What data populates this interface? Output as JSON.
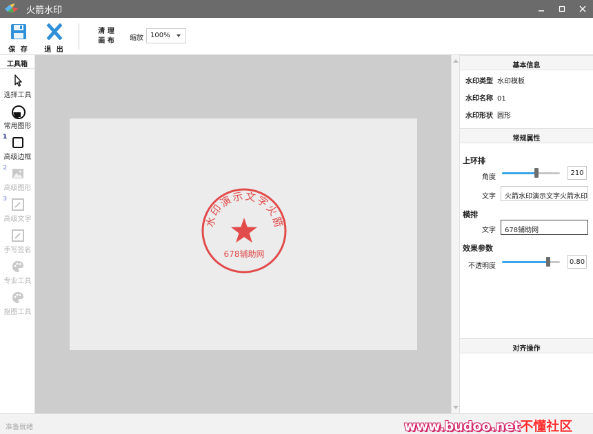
{
  "window": {
    "title": "火箭水印"
  },
  "toolbar": {
    "save_label": "保 存",
    "exit_label": "退 出",
    "clear_line1": "清 理",
    "clear_line2": "画 布",
    "zoom_label": "缩放",
    "zoom_value": "100%"
  },
  "toolbox": {
    "title": "工具箱",
    "tools": [
      {
        "label": "选择工具",
        "icon": "cursor-icon",
        "enabled": true
      },
      {
        "label": "常用图形",
        "icon": "circle-shape-icon",
        "enabled": true
      },
      {
        "label": "高级边框",
        "icon": "square-border-icon",
        "enabled": true,
        "badge": "1"
      },
      {
        "label": "高级图形",
        "icon": "image-icon",
        "enabled": false,
        "badge": "2"
      },
      {
        "label": "高级文字",
        "icon": "pen-icon",
        "enabled": false,
        "badge": "3"
      },
      {
        "label": "手写签名",
        "icon": "signature-pen-icon",
        "enabled": false
      },
      {
        "label": "专业工具",
        "icon": "palette-icon",
        "enabled": false
      },
      {
        "label": "抠图工具",
        "icon": "palette-icon",
        "enabled": false
      }
    ]
  },
  "stamp": {
    "ring_text": "火箭水印演示文字火箭水印",
    "center_text": "678辅助网",
    "color": "#e24b4b"
  },
  "panel": {
    "basic_info_title": "基本信息",
    "type_key": "水印类型",
    "type_value": "水印模板",
    "name_key": "水印名称",
    "name_value": "01",
    "shape_key": "水印形状",
    "shape_value": "圆形",
    "general_title": "常规属性",
    "arc_title": "上环排",
    "angle_label": "角度",
    "angle_value": "210",
    "angle_fraction": 0.6,
    "arc_text_label": "文字",
    "arc_text_value": "火箭水印演示文字火箭水印",
    "horizontal_title": "横排",
    "horiz_text_label": "文字",
    "horiz_text_value": "678辅助网",
    "effect_title": "效果参数",
    "opacity_label": "不透明度",
    "opacity_value": "0.80",
    "opacity_fraction": 0.8,
    "align_title": "对齐操作"
  },
  "status": {
    "text": "准备就绪"
  },
  "watermark": {
    "url": "www.budoo.net",
    "cn": "不懂社区"
  }
}
